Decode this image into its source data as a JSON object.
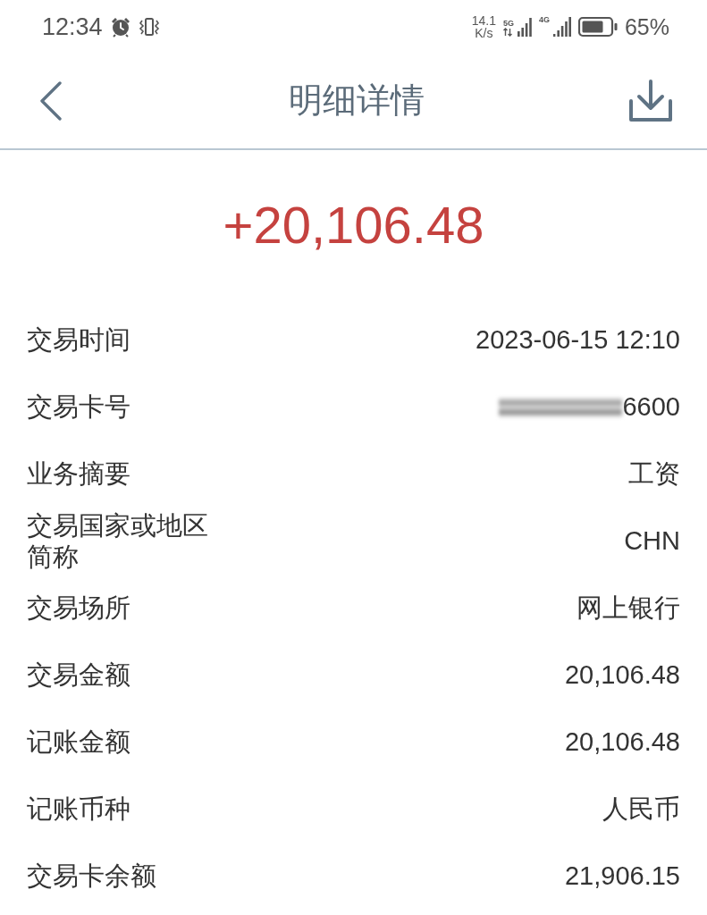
{
  "status_bar": {
    "time": "12:34",
    "speed_value": "14.1",
    "speed_unit": "K/s",
    "sim_1_network": "5G",
    "sim_2_network": "4G",
    "battery": "65%"
  },
  "header": {
    "title": "明细详情"
  },
  "amount": "+20,106.48",
  "rows": [
    {
      "label": "交易时间",
      "value": "2023-06-15 12:10",
      "masked": false
    },
    {
      "label": "交易卡号",
      "value": "6600",
      "masked": true
    },
    {
      "label": "业务摘要",
      "value": "工资",
      "masked": false
    },
    {
      "label": "交易国家或地区简称",
      "value": "CHN",
      "masked": false
    },
    {
      "label": "交易场所",
      "value": "网上银行",
      "masked": false
    },
    {
      "label": "交易金额",
      "value": "20,106.48",
      "masked": false
    },
    {
      "label": "记账金额",
      "value": "20,106.48",
      "masked": false
    },
    {
      "label": "记账币种",
      "value": "人民币",
      "masked": false
    },
    {
      "label": "交易卡余额",
      "value": "21,906.15",
      "masked": false
    }
  ]
}
